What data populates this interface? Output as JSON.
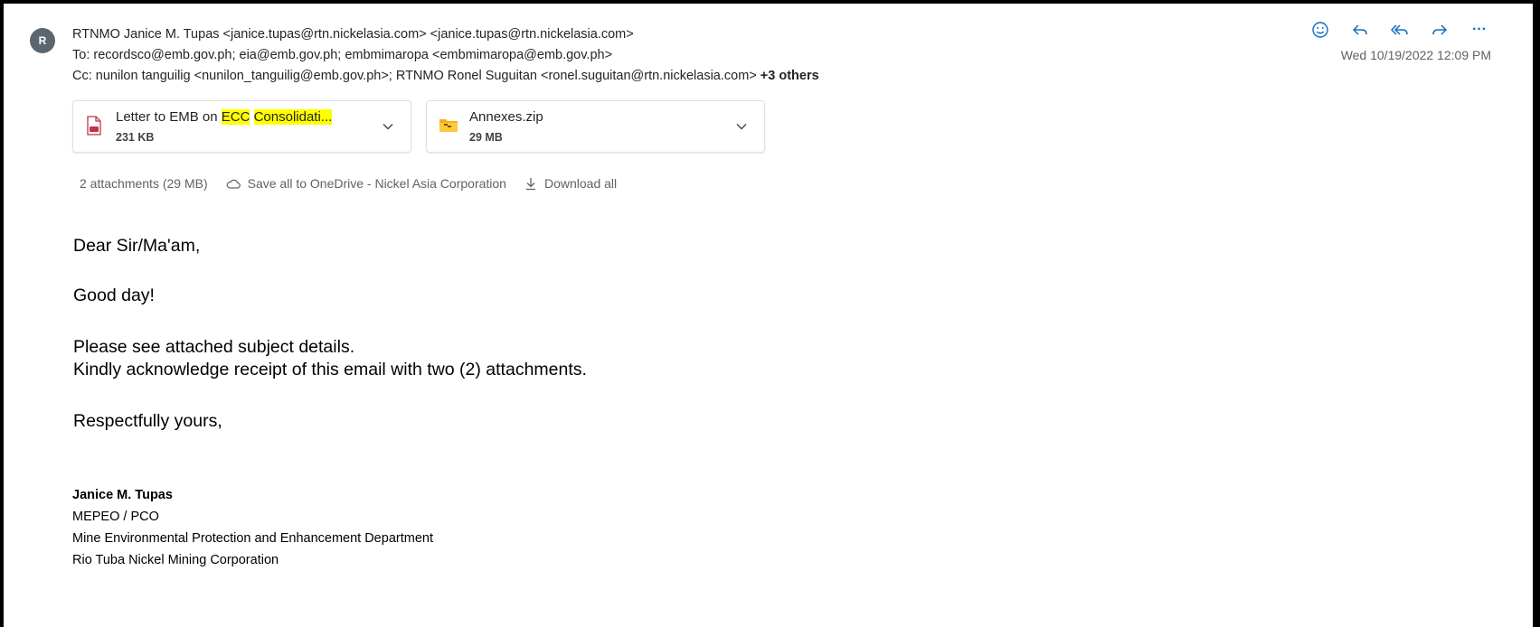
{
  "sender": {
    "avatar_initial": "R",
    "from_line": "RTNMO Janice M. Tupas <janice.tupas@rtn.nickelasia.com> <janice.tupas@rtn.nickelasia.com>",
    "to_line": "To: recordsco@emb.gov.ph; eia@emb.gov.ph; embmimaropa <embmimaropa@emb.gov.ph>",
    "cc_line": "Cc: nunilon tanguilig <nunilon_tanguilig@emb.gov.ph>; RTNMO Ronel Suguitan <ronel.suguitan@rtn.nickelasia.com>",
    "cc_more": "+3 others",
    "datetime": "Wed 10/19/2022 12:09 PM"
  },
  "actions": {
    "icons": [
      "emoji-icon",
      "reply-icon",
      "reply-all-icon",
      "forward-icon",
      "more-icon"
    ],
    "more_label": "···"
  },
  "attachments": [
    {
      "name_prefix": "Letter to EMB on ",
      "name_hl1": "ECC",
      "name_sep": " ",
      "name_hl2": "Consolidati...",
      "size": "231 KB",
      "icon": "pdf-file-icon"
    },
    {
      "name": "Annexes.zip",
      "size": "29 MB",
      "icon": "zip-folder-icon"
    }
  ],
  "attachment_bar": {
    "summary": "2 attachments (29 MB)",
    "save_label": "Save all to OneDrive - Nickel Asia Corporation",
    "download_label": "Download all"
  },
  "body": {
    "greeting": "Dear Sir/Ma'am,",
    "line2": "Good day!",
    "line3": "Please see attached subject details.",
    "line4": "Kindly acknowledge receipt of this email with two (2) attachments.",
    "closing": "Respectfully yours,"
  },
  "signature": {
    "name": "Janice M. Tupas",
    "title": "MEPEO / PCO",
    "department": "Mine Environmental Protection and Enhancement Department",
    "company": "Rio Tuba Nickel Mining Corporation"
  },
  "colors": {
    "highlight": "#ffff00",
    "accent": "#0f6cbd",
    "avatar": "#5b6770"
  }
}
